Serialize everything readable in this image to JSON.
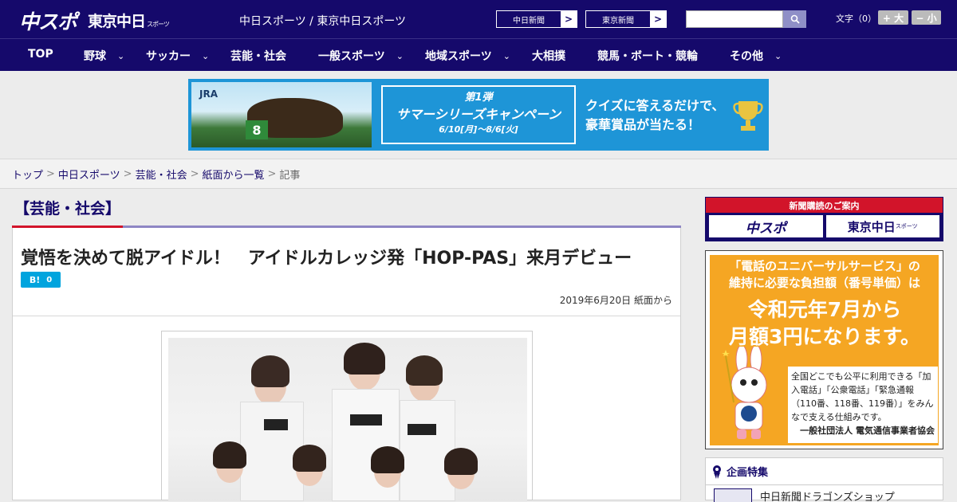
{
  "header": {
    "logo_chuspo": "中スポ",
    "logo_tokyo": "東京中日",
    "logo_tokyo_sub": "スポーツ",
    "site_title": "中日スポーツ / 東京中日スポーツ",
    "newspaper_links": [
      {
        "label": "中日新聞",
        "arrow": ">"
      },
      {
        "label": "東京新聞",
        "arrow": ">"
      }
    ],
    "search": {
      "value": "",
      "placeholder": ""
    },
    "font_size_label": "文字（0）",
    "font_bigger": "+ 大",
    "font_smaller": "− 小"
  },
  "nav": [
    {
      "label": "TOP",
      "dropdown": false
    },
    {
      "label": "野球",
      "dropdown": true
    },
    {
      "label": "サッカー",
      "dropdown": true
    },
    {
      "label": "芸能・社会",
      "dropdown": false
    },
    {
      "label": "一般スポーツ",
      "dropdown": true
    },
    {
      "label": "地域スポーツ",
      "dropdown": true
    },
    {
      "label": "大相撲",
      "dropdown": false
    },
    {
      "label": "競馬・ボート・競輪",
      "dropdown": false
    },
    {
      "label": "その他",
      "dropdown": true
    }
  ],
  "nav_chevron": "⌄",
  "banner": {
    "jra": "JRA",
    "horse_number": "8",
    "campaign_no": "第1弾",
    "campaign_title": "サマーシリーズキャンペーン",
    "campaign_dates": "6/10[月]〜8/6[火]",
    "quiz_line1": "クイズに答えるだけで、",
    "quiz_line2": "豪華賞品が当たる！"
  },
  "breadcrumb": {
    "items": [
      "トップ",
      "中日スポーツ",
      "芸能・社会",
      "紙面から一覧"
    ],
    "current": "記事",
    "separator": ">"
  },
  "article": {
    "category": "【芸能・社会】",
    "title": "覚悟を決めて脱アイドル！　アイドルカレッジ発「HOP-PAS」来月デビュー",
    "hatena_label": "B!",
    "hatena_count": "0",
    "date": "2019年6月20日 紙面から"
  },
  "sidebar": {
    "subscribe_head": "新聞購読のご案内",
    "subscribe_logos": [
      "中スポ",
      "東京中日"
    ],
    "subscribe_logo_sub": "スポーツ",
    "ad": {
      "line1": "「電話のユニバーサルサービス」の",
      "line2": "維持に必要な負担額（番号単価）は",
      "line3": "令和元年7月から",
      "line4": "月額3円になります。",
      "body": "全国どこでも公平に利用できる「加入電話」「公衆電話」「緊急通報（110番、118番、119番）」をみんなで支える仕組みです。",
      "org": "一般社団法人 電気通信事業者協会"
    },
    "kikaku_title": "企画特集",
    "kikaku_item": "中日新聞ドラゴンズショップ"
  },
  "colors": {
    "navy": "#15096b",
    "red": "#d2142a",
    "hatena_blue": "#00a4de",
    "ad_orange": "#f5a623"
  }
}
